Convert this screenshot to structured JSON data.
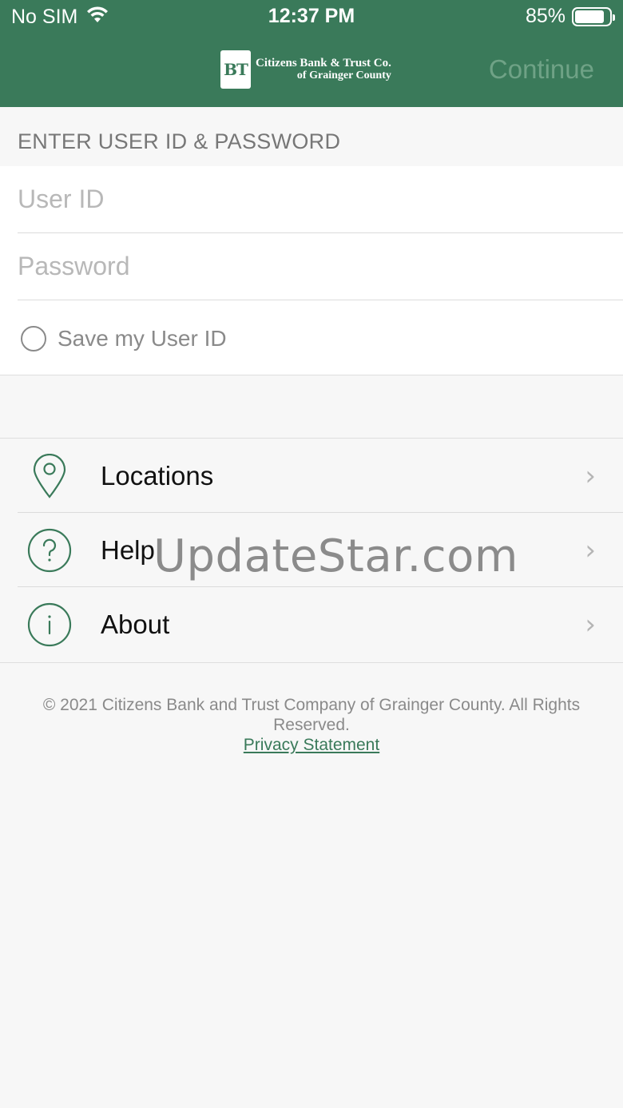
{
  "status_bar": {
    "carrier": "No SIM",
    "time": "12:37 PM",
    "battery": "85%",
    "battery_level": 0.85
  },
  "header": {
    "logo_mark": "BT",
    "logo_line1": "Citizens Bank & Trust Co.",
    "logo_line2": "of Grainger County",
    "continue_label": "Continue"
  },
  "login": {
    "section_label": "ENTER USER ID & PASSWORD",
    "user_id_placeholder": "User ID",
    "password_placeholder": "Password",
    "save_user_id_label": "Save my User ID"
  },
  "menu": {
    "items": [
      {
        "label": "Locations",
        "icon": "location-pin-icon"
      },
      {
        "label": "Help",
        "icon": "question-circle-icon"
      },
      {
        "label": "About",
        "icon": "info-circle-icon"
      }
    ]
  },
  "footer": {
    "copyright": "© 2021 Citizens Bank and Trust Company of Grainger County. All Rights Reserved.",
    "privacy_link": "Privacy Statement"
  },
  "watermark": "UpdateStar.com",
  "colors": {
    "brand_green": "#3a7a5a",
    "continue_disabled": "#6fa286",
    "background": "#f7f7f7"
  }
}
